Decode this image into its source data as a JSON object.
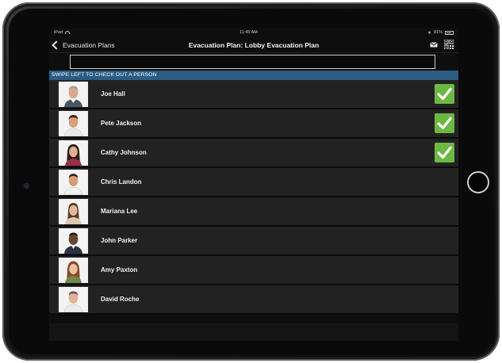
{
  "status": {
    "carrier": "iPad",
    "time": "11:45 AM",
    "battery": "81%"
  },
  "nav": {
    "back_label": "Evacuation Plans",
    "title": "Evacuation Plan: Lobby Evacuation Plan"
  },
  "search": {
    "value": "",
    "placeholder": ""
  },
  "hint": "SWIPE LEFT TO CHECK OUT A PERSON",
  "people": [
    {
      "name": "Joe Hall",
      "checked": true
    },
    {
      "name": "Pete Jackson",
      "checked": true
    },
    {
      "name": "Cathy Johnson",
      "checked": true
    },
    {
      "name": "Chris Landon",
      "checked": false
    },
    {
      "name": "Mariana Lee",
      "checked": false
    },
    {
      "name": "John Parker",
      "checked": false
    },
    {
      "name": "Amy Paxton",
      "checked": false
    },
    {
      "name": "David Roche",
      "checked": false
    }
  ],
  "icons": {
    "back": "chevron-left-icon",
    "mail": "mail-icon",
    "qr": "qr-code-icon",
    "check": "checkmark-icon"
  },
  "colors": {
    "hint_bg": "#2a5c84",
    "check_green": "#6db843",
    "row_bg": "#222222"
  }
}
